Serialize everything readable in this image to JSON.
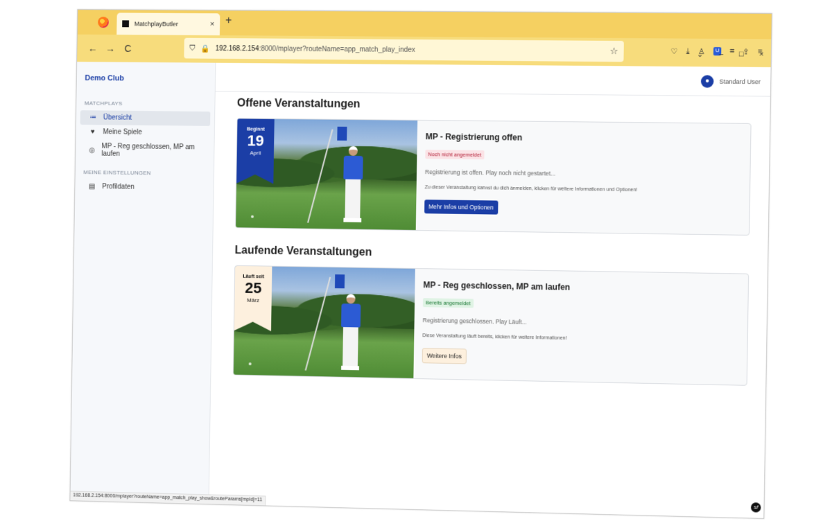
{
  "browser": {
    "tab_title": "MatchplayButler",
    "tab_close": "×",
    "new_tab": "+",
    "url_host": "192.168.2.154",
    "url_rest": ":8000/mplayer?routeName=app_match_play_index",
    "back_icon": "←",
    "forward_icon": "→",
    "reload_icon": "C",
    "star_icon": "☆",
    "shield_icon": "⛉",
    "lock_icon": "🔒",
    "win_min": "–",
    "win_max": "□",
    "win_close": "×",
    "dropdown": "⌄",
    "tb_pocket": "♡",
    "tb_download": "⤓",
    "tb_ext1": "♙",
    "tb_bitwarden": "U",
    "tb_crop": "⌗",
    "tb_share": "⇪",
    "tb_menu": "≡",
    "status_url": "192.168.2.154:8000/mplayer?routeName=app_match_play_show&routeParams[mpId]=11"
  },
  "sidebar": {
    "brand": "Demo Club",
    "sections": [
      {
        "heading": "MATCHPLAYS",
        "items": [
          {
            "label": "Übersicht",
            "icon": "≔"
          },
          {
            "label": "Meine Spiele",
            "icon": "♥"
          },
          {
            "label": "MP - Reg geschlossen, MP am laufen",
            "icon": "◎"
          }
        ]
      },
      {
        "heading": "MEINE EINSTELLUNGEN",
        "items": [
          {
            "label": "Profildaten",
            "icon": "▤"
          }
        ]
      }
    ]
  },
  "user": {
    "name": "Standard User",
    "avatar_icon": "●"
  },
  "sections": [
    {
      "title": "Offene Veranstaltungen",
      "card": {
        "ribbon_small": "Beginnt",
        "ribbon_day": "19",
        "ribbon_month": "April",
        "title": "MP - Registrierung offen",
        "badge": "Noch nicht angemeldet",
        "status": "Registrierung ist offen. Play noch nicht gestartet...",
        "desc": "Zu dieser Veranstaltung kannst du dich anmelden, klicken für weitere Informationen und Optionen!",
        "button": "Mehr Infos und Optionen"
      }
    },
    {
      "title": "Laufende Veranstaltungen",
      "card": {
        "ribbon_small": "Läuft seit",
        "ribbon_day": "25",
        "ribbon_month": "März",
        "title": "MP - Reg geschlossen, MP am laufen",
        "badge": "Bereits angemeldet",
        "status": "Registrierung geschlossen. Play Läuft...",
        "desc": "Diese Veranstaltung läuft bereits, klicken für weitere Informationen!",
        "button": "Weitere Infos"
      }
    }
  ],
  "footer": {
    "symfony_icon": "sf"
  },
  "colors": {
    "accent": "#1b3ea6",
    "tabstrip": "#f5d061",
    "navbar": "#f7dc7c"
  }
}
